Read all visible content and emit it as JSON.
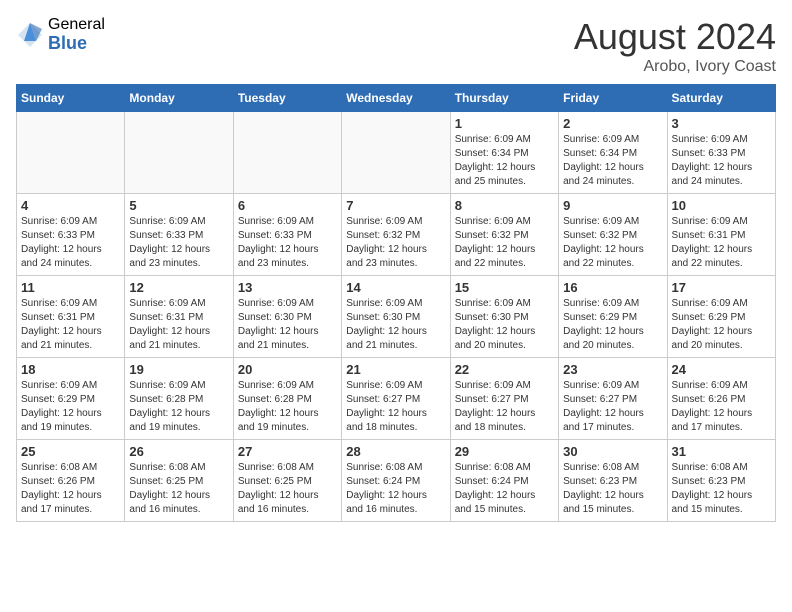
{
  "logo": {
    "general": "General",
    "blue": "Blue"
  },
  "header": {
    "title": "August 2024",
    "subtitle": "Arobo, Ivory Coast"
  },
  "weekdays": [
    "Sunday",
    "Monday",
    "Tuesday",
    "Wednesday",
    "Thursday",
    "Friday",
    "Saturday"
  ],
  "weeks": [
    [
      {
        "day": "",
        "info": ""
      },
      {
        "day": "",
        "info": ""
      },
      {
        "day": "",
        "info": ""
      },
      {
        "day": "",
        "info": ""
      },
      {
        "day": "1",
        "info": "Sunrise: 6:09 AM\nSunset: 6:34 PM\nDaylight: 12 hours\nand 25 minutes."
      },
      {
        "day": "2",
        "info": "Sunrise: 6:09 AM\nSunset: 6:34 PM\nDaylight: 12 hours\nand 24 minutes."
      },
      {
        "day": "3",
        "info": "Sunrise: 6:09 AM\nSunset: 6:33 PM\nDaylight: 12 hours\nand 24 minutes."
      }
    ],
    [
      {
        "day": "4",
        "info": "Sunrise: 6:09 AM\nSunset: 6:33 PM\nDaylight: 12 hours\nand 24 minutes."
      },
      {
        "day": "5",
        "info": "Sunrise: 6:09 AM\nSunset: 6:33 PM\nDaylight: 12 hours\nand 23 minutes."
      },
      {
        "day": "6",
        "info": "Sunrise: 6:09 AM\nSunset: 6:33 PM\nDaylight: 12 hours\nand 23 minutes."
      },
      {
        "day": "7",
        "info": "Sunrise: 6:09 AM\nSunset: 6:32 PM\nDaylight: 12 hours\nand 23 minutes."
      },
      {
        "day": "8",
        "info": "Sunrise: 6:09 AM\nSunset: 6:32 PM\nDaylight: 12 hours\nand 22 minutes."
      },
      {
        "day": "9",
        "info": "Sunrise: 6:09 AM\nSunset: 6:32 PM\nDaylight: 12 hours\nand 22 minutes."
      },
      {
        "day": "10",
        "info": "Sunrise: 6:09 AM\nSunset: 6:31 PM\nDaylight: 12 hours\nand 22 minutes."
      }
    ],
    [
      {
        "day": "11",
        "info": "Sunrise: 6:09 AM\nSunset: 6:31 PM\nDaylight: 12 hours\nand 21 minutes."
      },
      {
        "day": "12",
        "info": "Sunrise: 6:09 AM\nSunset: 6:31 PM\nDaylight: 12 hours\nand 21 minutes."
      },
      {
        "day": "13",
        "info": "Sunrise: 6:09 AM\nSunset: 6:30 PM\nDaylight: 12 hours\nand 21 minutes."
      },
      {
        "day": "14",
        "info": "Sunrise: 6:09 AM\nSunset: 6:30 PM\nDaylight: 12 hours\nand 21 minutes."
      },
      {
        "day": "15",
        "info": "Sunrise: 6:09 AM\nSunset: 6:30 PM\nDaylight: 12 hours\nand 20 minutes."
      },
      {
        "day": "16",
        "info": "Sunrise: 6:09 AM\nSunset: 6:29 PM\nDaylight: 12 hours\nand 20 minutes."
      },
      {
        "day": "17",
        "info": "Sunrise: 6:09 AM\nSunset: 6:29 PM\nDaylight: 12 hours\nand 20 minutes."
      }
    ],
    [
      {
        "day": "18",
        "info": "Sunrise: 6:09 AM\nSunset: 6:29 PM\nDaylight: 12 hours\nand 19 minutes."
      },
      {
        "day": "19",
        "info": "Sunrise: 6:09 AM\nSunset: 6:28 PM\nDaylight: 12 hours\nand 19 minutes."
      },
      {
        "day": "20",
        "info": "Sunrise: 6:09 AM\nSunset: 6:28 PM\nDaylight: 12 hours\nand 19 minutes."
      },
      {
        "day": "21",
        "info": "Sunrise: 6:09 AM\nSunset: 6:27 PM\nDaylight: 12 hours\nand 18 minutes."
      },
      {
        "day": "22",
        "info": "Sunrise: 6:09 AM\nSunset: 6:27 PM\nDaylight: 12 hours\nand 18 minutes."
      },
      {
        "day": "23",
        "info": "Sunrise: 6:09 AM\nSunset: 6:27 PM\nDaylight: 12 hours\nand 17 minutes."
      },
      {
        "day": "24",
        "info": "Sunrise: 6:09 AM\nSunset: 6:26 PM\nDaylight: 12 hours\nand 17 minutes."
      }
    ],
    [
      {
        "day": "25",
        "info": "Sunrise: 6:08 AM\nSunset: 6:26 PM\nDaylight: 12 hours\nand 17 minutes."
      },
      {
        "day": "26",
        "info": "Sunrise: 6:08 AM\nSunset: 6:25 PM\nDaylight: 12 hours\nand 16 minutes."
      },
      {
        "day": "27",
        "info": "Sunrise: 6:08 AM\nSunset: 6:25 PM\nDaylight: 12 hours\nand 16 minutes."
      },
      {
        "day": "28",
        "info": "Sunrise: 6:08 AM\nSunset: 6:24 PM\nDaylight: 12 hours\nand 16 minutes."
      },
      {
        "day": "29",
        "info": "Sunrise: 6:08 AM\nSunset: 6:24 PM\nDaylight: 12 hours\nand 15 minutes."
      },
      {
        "day": "30",
        "info": "Sunrise: 6:08 AM\nSunset: 6:23 PM\nDaylight: 12 hours\nand 15 minutes."
      },
      {
        "day": "31",
        "info": "Sunrise: 6:08 AM\nSunset: 6:23 PM\nDaylight: 12 hours\nand 15 minutes."
      }
    ]
  ]
}
